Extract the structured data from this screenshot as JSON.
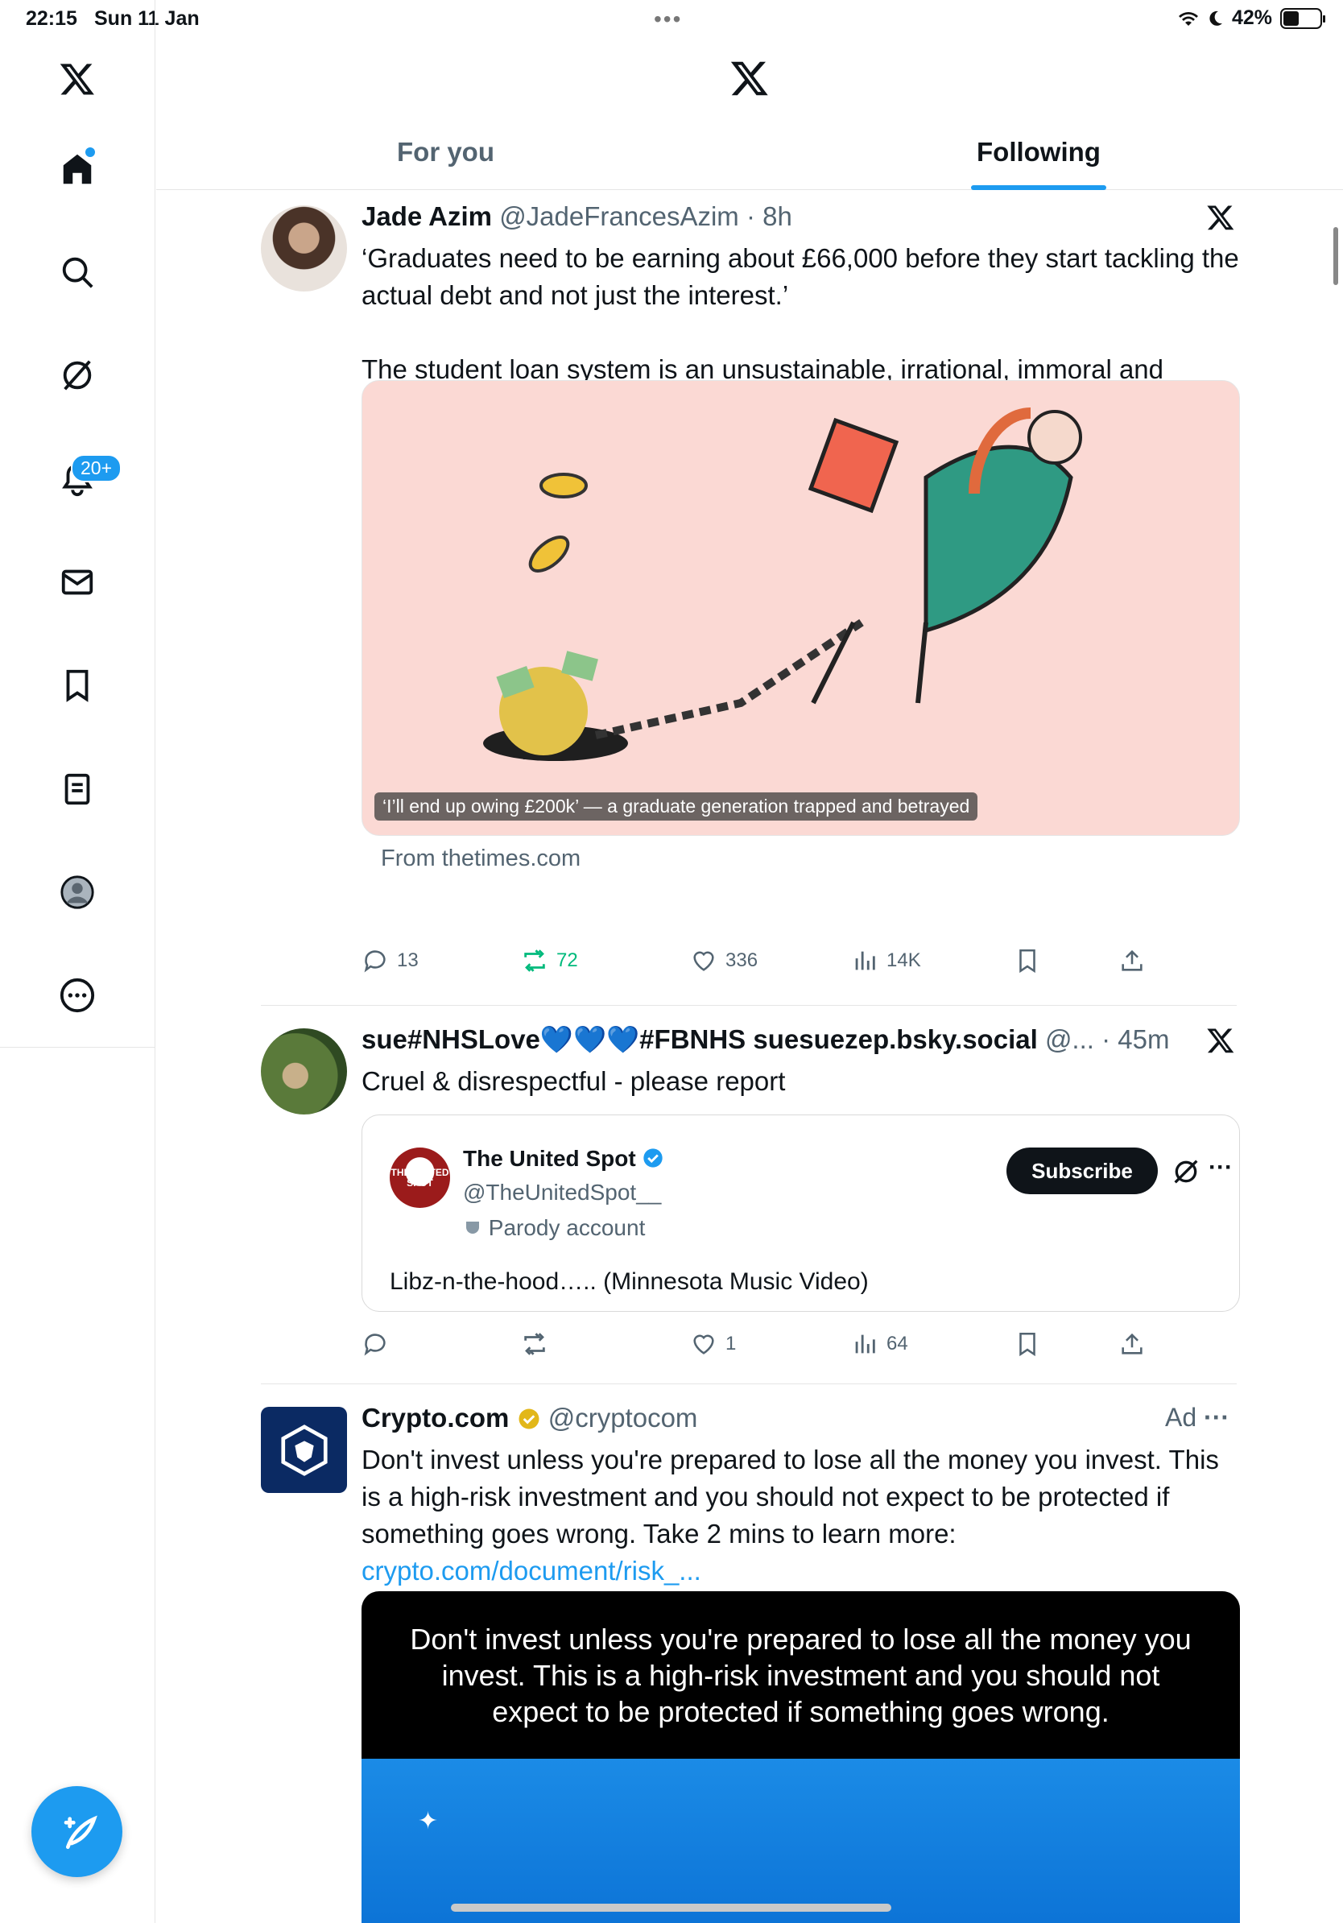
{
  "status_bar": {
    "time": "22:15",
    "date": "Sun 11 Jan",
    "battery": "42%"
  },
  "sidebar": {
    "notifications_badge": "20+"
  },
  "tabs": [
    {
      "label": "For you"
    },
    {
      "label": "Following"
    }
  ],
  "posts": [
    {
      "name": "Jade Azim",
      "handle": "@JadeFrancesAzim",
      "time": "8h",
      "text": "‘Graduates need to be earning about £66,000 before they start tackling the actual debt and not just the interest.’\n\nThe student loan system is an unsustainable, irrational, immoral and classist system that’s been ignored by politicians for far too long.",
      "media_caption": "‘I’ll end up owing £200k’ — a graduate generation trapped and betrayed",
      "from": "From thetimes.com",
      "replies": "13",
      "reposts": "72",
      "likes": "336",
      "views": "14K"
    },
    {
      "name": "sue#NHSLove💙💙💙#FBNHS suesuezep.bsky.social",
      "handle": "@...",
      "time": "45m",
      "text": "Cruel & disrespectful - please report",
      "quote": {
        "name": "The United Spot",
        "handle": "@TheUnitedSpot__",
        "label": "Parody account",
        "subscribe": "Subscribe",
        "text": "Libz-n-the-hood….. (Minnesota Music Video)",
        "avatar_text": "THE UNITED SPOT"
      },
      "replies": "",
      "reposts": "",
      "likes": "1",
      "views": "64"
    },
    {
      "name": "Crypto.com",
      "handle": "@cryptocom",
      "ad_label": "Ad",
      "text": "Don't invest unless you're prepared to lose all the money you invest. This is a high-risk investment and you should not expect to be protected if something goes wrong. Take 2 mins to learn more:",
      "link": "crypto.com/document/risk_...",
      "media_text": "Don't invest unless you're prepared to lose all the money you invest. This is a high-risk investment and you should not expect to be protected if something goes wrong."
    }
  ]
}
